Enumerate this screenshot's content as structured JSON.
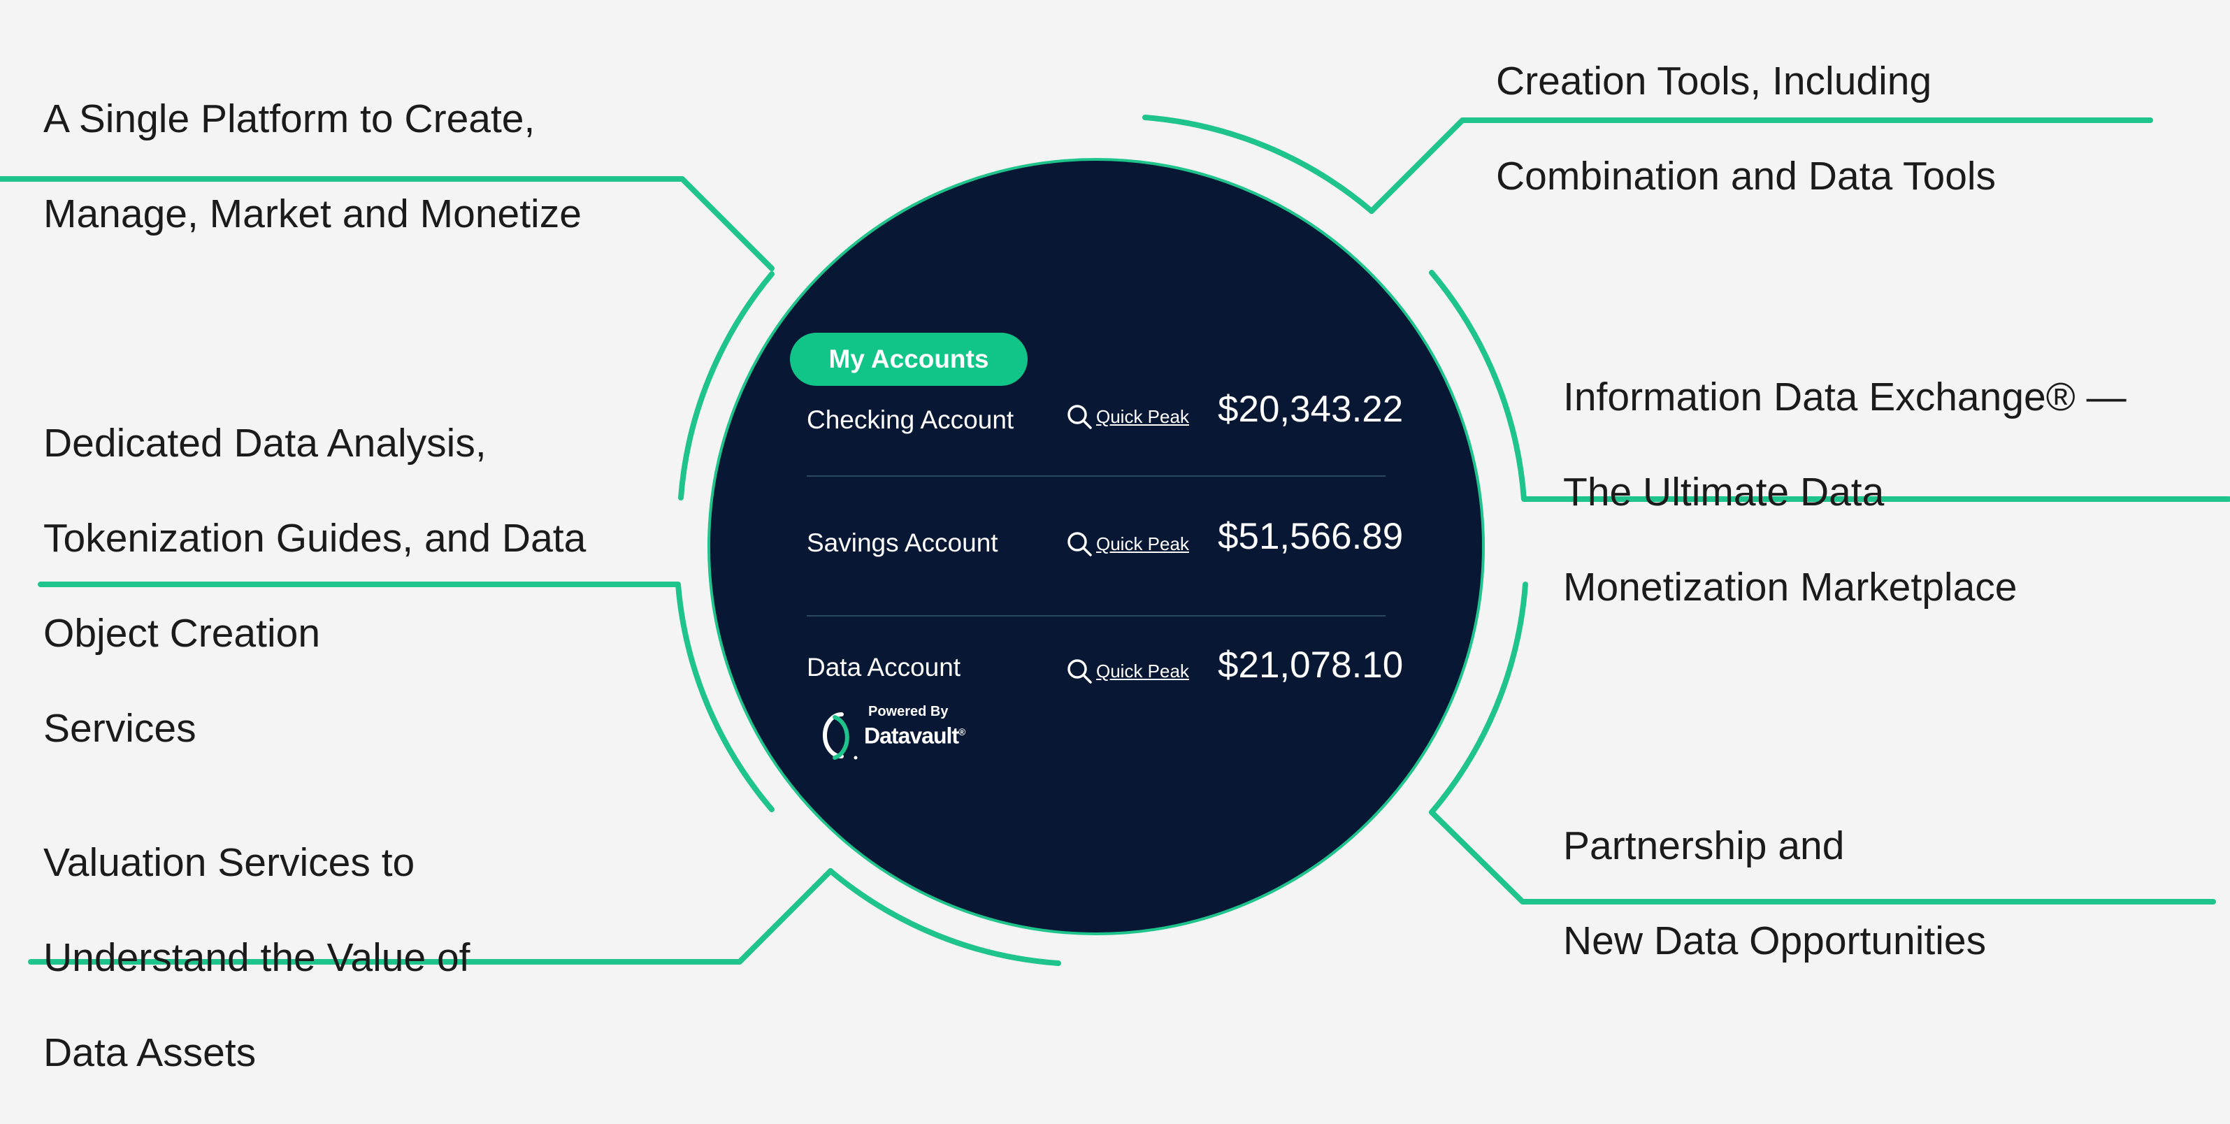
{
  "features": {
    "platform": {
      "lines": [
        "A Single Platform to Create,",
        "Manage, Market and Monetize"
      ]
    },
    "analysis": {
      "lines": [
        "Dedicated Data Analysis,",
        "Tokenization Guides, and Data",
        "Object Creation",
        "Services"
      ]
    },
    "valuation": {
      "lines": [
        "Valuation Services to",
        "Understand the Value of",
        "Data Assets"
      ]
    },
    "creation": {
      "lines": [
        "Creation Tools, Including",
        "Combination and Data Tools"
      ]
    },
    "ide": {
      "lines": [
        "Information Data Exchange® —",
        "The Ultimate Data",
        "Monetization Marketplace"
      ]
    },
    "partner": {
      "lines": [
        "Partnership and",
        "New Data Opportunities"
      ]
    }
  },
  "accounts_panel": {
    "button_label": "My Accounts",
    "accounts": [
      {
        "name": "Checking Account",
        "link_label": "Quick Peak",
        "balance": "$20,343.22"
      },
      {
        "name": "Savings Account",
        "link_label": "Quick Peak",
        "balance": "$51,566.89"
      },
      {
        "name": "Data Account",
        "link_label": "Quick Peak",
        "balance": "$21,078.10"
      }
    ],
    "powered_by": "Powered By",
    "brand": "Datavault",
    "brand_mark": "®"
  },
  "colors": {
    "accent": "#1ec48c",
    "circle_bg": "#081733",
    "page_bg": "#f4f4f4",
    "text": "#1b1b1b"
  },
  "icons": {
    "quick_peak": "search-icon",
    "brand": "datavault-logo-icon"
  }
}
